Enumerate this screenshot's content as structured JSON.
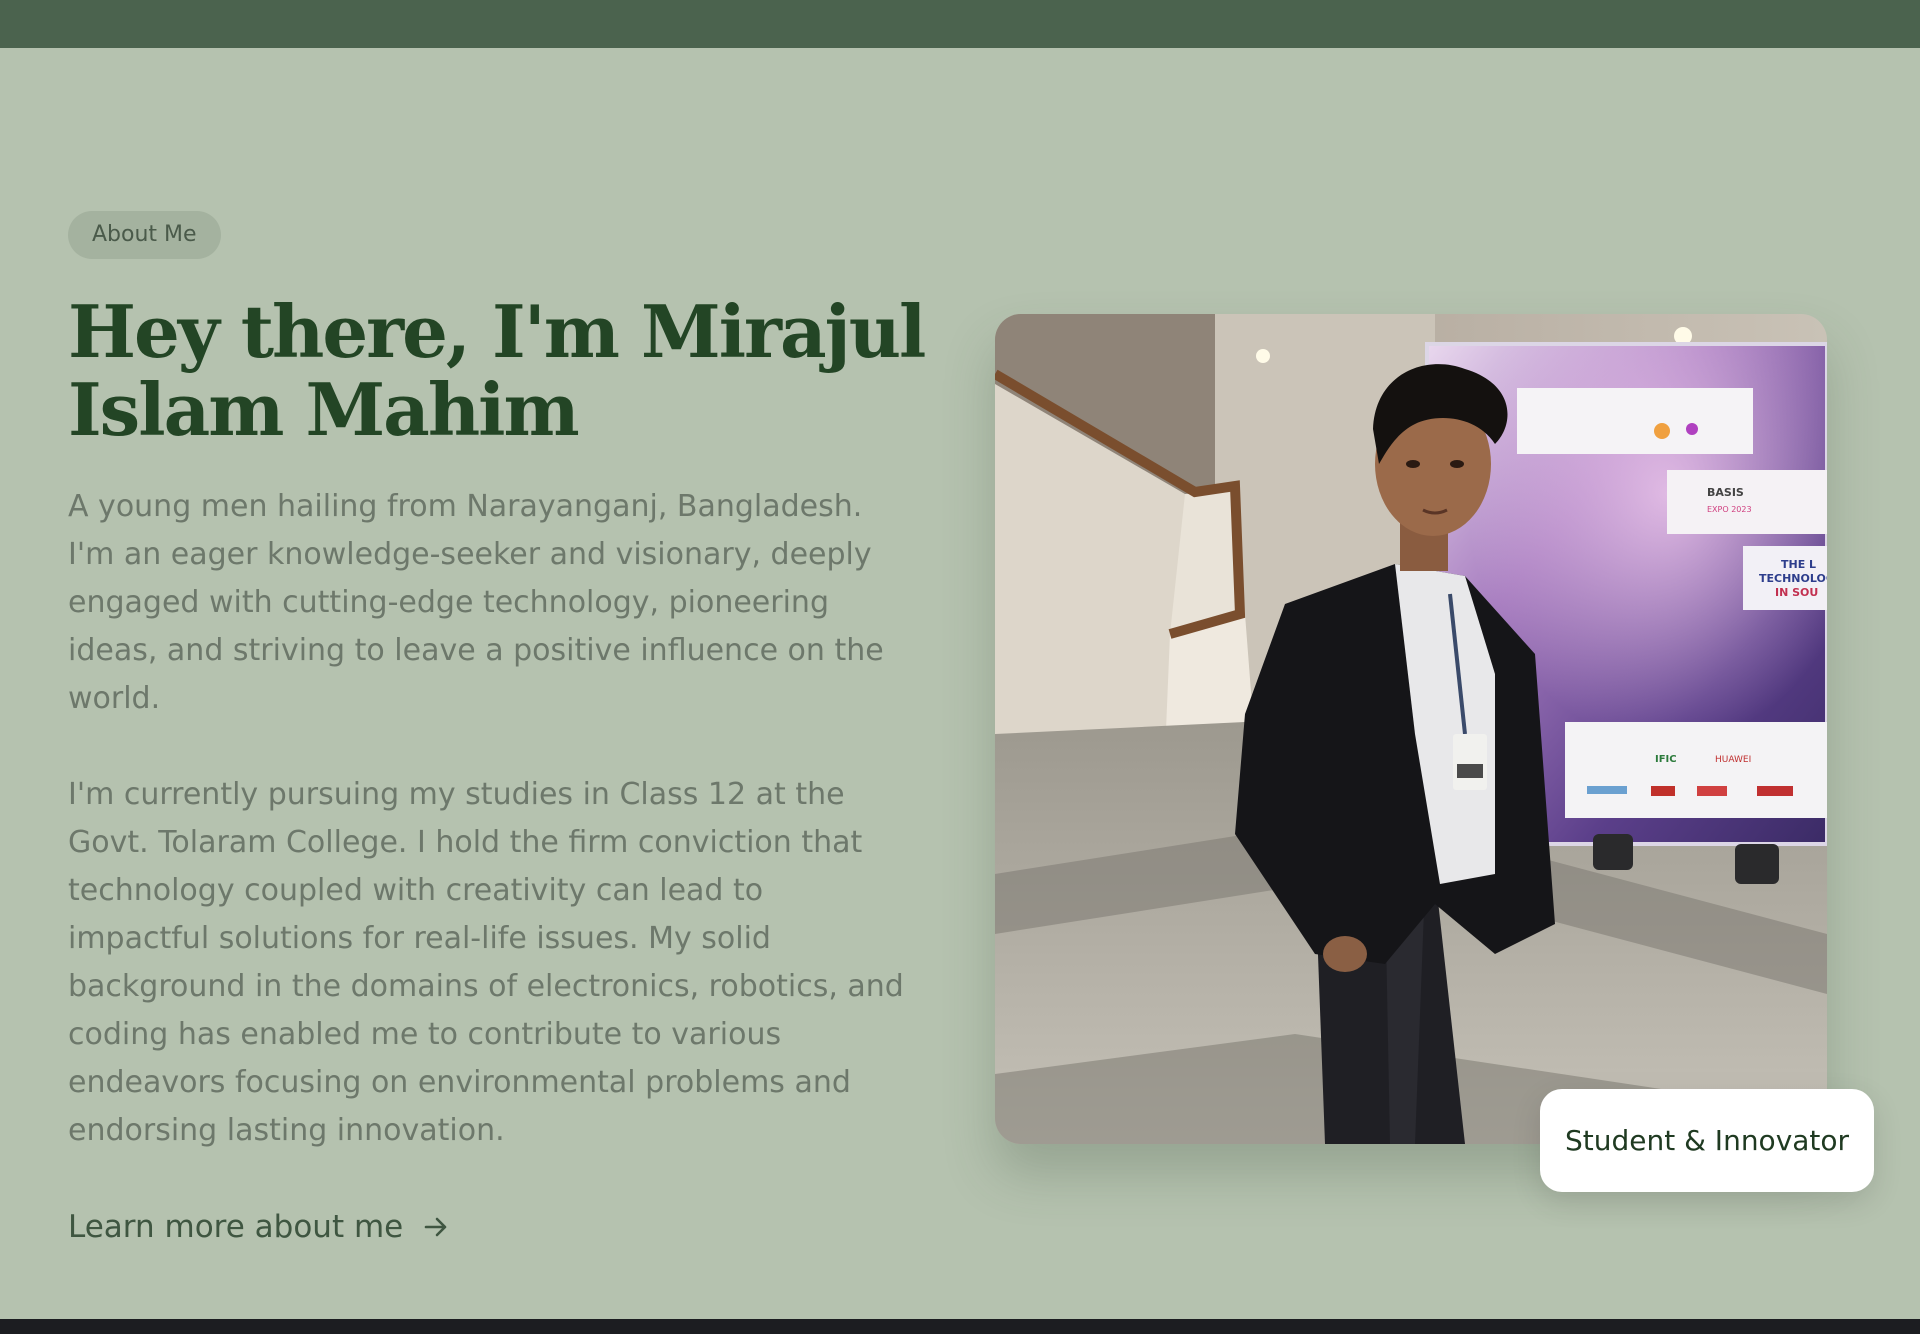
{
  "section": {
    "pill_label": "About Me",
    "heading": "Hey there, I'm Mirajul Islam Mahim",
    "paragraph_1": "A young men hailing from Narayanganj, Bangladesh. I'm an eager knowledge-seeker and visionary, deeply engaged with cutting-edge technology, pioneering ideas, and striving to leave a positive influence on the world.",
    "paragraph_2": "I'm currently pursuing my studies in Class 12 at the Govt. Tolaram College. I hold the firm conviction that technology coupled with creativity can lead to impactful solutions for real-life issues. My solid background in the domains of electronics, robotics, and coding has enabled me to contribute to various endeavors focusing on environmental problems and endorsing lasting innovation.",
    "learn_more_label": "Learn more about me",
    "learn_more_icon": "arrow-right-icon"
  },
  "photo": {
    "badge_label": "Student & Innovator",
    "banner_texts": [
      "BASIS",
      "EXPO 2023",
      "THE L",
      "TECHNOLOG",
      "IN SOU",
      "IFIC",
      "HUAWEI"
    ]
  },
  "colors": {
    "background": "#b5c2af",
    "top_bar": "#4b634e",
    "heading": "#234525",
    "body_text": "#6d786b",
    "pill_bg": "#a4b29f"
  }
}
